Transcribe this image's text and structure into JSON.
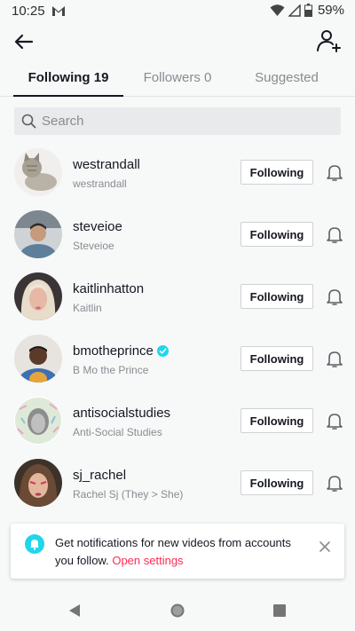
{
  "status_bar": {
    "time": "10:25",
    "battery": "59%"
  },
  "tabs": [
    {
      "label": "Following 19"
    },
    {
      "label": "Followers 0"
    },
    {
      "label": "Suggested"
    }
  ],
  "search": {
    "placeholder": "Search"
  },
  "accounts": [
    {
      "username": "westrandall",
      "display_name": "westrandall",
      "verified": false,
      "button": "Following"
    },
    {
      "username": "steveioe",
      "display_name": "Steveioe",
      "verified": false,
      "button": "Following"
    },
    {
      "username": "kaitlinhatton",
      "display_name": "Kaitlin",
      "verified": false,
      "button": "Following"
    },
    {
      "username": "bmotheprince",
      "display_name": "B Mo the Prince",
      "verified": true,
      "button": "Following"
    },
    {
      "username": "antisocialstudies",
      "display_name": "Anti-Social Studies",
      "verified": false,
      "button": "Following"
    },
    {
      "username": "sj_rachel",
      "display_name": "Rachel Sj (They > She)",
      "verified": false,
      "button": "Following"
    }
  ],
  "banner": {
    "text": "Get notifications for new videos from accounts you follow.",
    "link": "Open settings"
  },
  "colors": {
    "accent": "#fe2c55",
    "verified": "#20d5ec"
  }
}
